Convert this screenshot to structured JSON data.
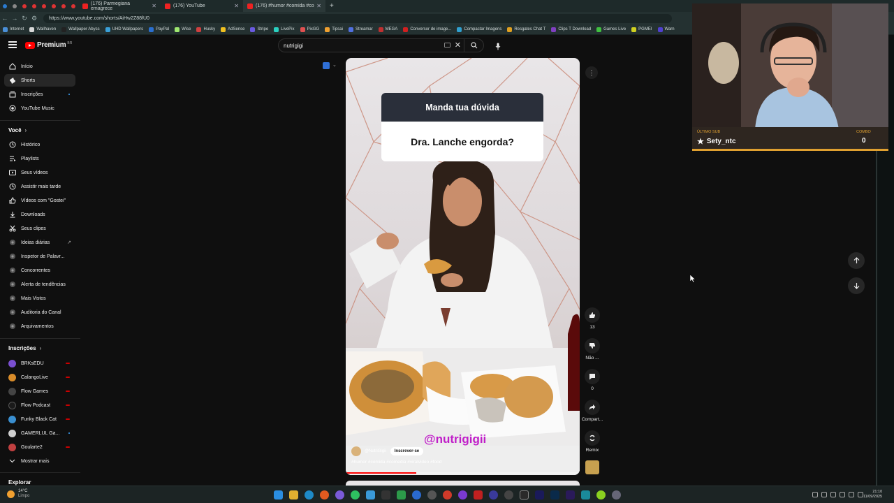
{
  "browser": {
    "tabs": [
      {
        "title": "(176) Parmegiana emagrece"
      },
      {
        "title": "(176) YouTube"
      },
      {
        "title": "(176) #humor #comida #co"
      }
    ],
    "url": "https://www.youtube.com/shorts/AiHw2Z88fU0",
    "bookmarks": [
      "Internet",
      "Wallhaven",
      "Wallpaper Abyss",
      "UHD Wallpapers",
      "PayPal",
      "Wise",
      "Husky",
      "AdSense",
      "Stripe",
      "LivePix",
      "PixGG",
      "Tipsai",
      "Streamar",
      "MEGA",
      "Conversor de image...",
      "Compactar Imagens",
      "Resgates Chat T",
      "Clips T Download",
      "Games Live",
      "PGMEI",
      "Warn"
    ]
  },
  "youtube": {
    "logo_text": "Premium",
    "logo_region": "BR",
    "search_value": "nutrigigi",
    "sidebar": {
      "main": [
        {
          "label": "Início"
        },
        {
          "label": "Shorts"
        },
        {
          "label": "Inscrições"
        },
        {
          "label": "YouTube Music"
        }
      ],
      "you_header": "Você",
      "you": [
        {
          "label": "Histórico"
        },
        {
          "label": "Playlists"
        },
        {
          "label": "Seus vídeos"
        },
        {
          "label": "Assistir mais tarde"
        },
        {
          "label": "Vídeos com \"Gostei\""
        },
        {
          "label": "Downloads"
        },
        {
          "label": "Seus clipes"
        },
        {
          "label": "Ideias diárias"
        },
        {
          "label": "Inspetor de Palavr..."
        },
        {
          "label": "Concorrentes"
        },
        {
          "label": "Alerta de tendências"
        },
        {
          "label": "Mais Vistos"
        },
        {
          "label": "Auditoria do Canal"
        },
        {
          "label": "Arquivamentos"
        }
      ],
      "subs_header": "Inscrições",
      "subs": [
        {
          "label": "BRKsEDU",
          "color": "#7a4fd0"
        },
        {
          "label": "CalangoLive",
          "color": "#d88c2a"
        },
        {
          "label": "Flow Games",
          "color": "#444444"
        },
        {
          "label": "Flow Podcast",
          "color": "#1a1a1a"
        },
        {
          "label": "Funky Black Cat",
          "color": "#3a8fd0"
        },
        {
          "label": "GAMERLUL Ga...",
          "color": "#cfcfcf"
        },
        {
          "label": "Goularte2",
          "color": "#c04040"
        }
      ],
      "show_more": "Mostrar mais",
      "explore_header": "Explorar"
    },
    "short": {
      "card_title": "Manda tua dúvida",
      "card_question": "Dra. Lanche engorda?",
      "overlay_handle": "@nutrigigii",
      "channel": "@NutriGigii",
      "subscribe": "Inscrever-se",
      "hashtags": "#humor #comida #comedia #viralvideo #food",
      "progress": 0.3
    },
    "actions": {
      "like_count": "13",
      "dislike_label": "Não ...",
      "comments_count": "0",
      "share_label": "Compart...",
      "remix_label": "Remix"
    }
  },
  "stream_overlay": {
    "last_sub_label": "ÚLTIMO SUB",
    "last_sub": "Sety_ntc",
    "combo_label": "COMBO",
    "combo_value": "0"
  },
  "taskbar": {
    "temp": "14°C",
    "weather": "Limpo",
    "time": "21:10",
    "date": "11/09/2025"
  }
}
